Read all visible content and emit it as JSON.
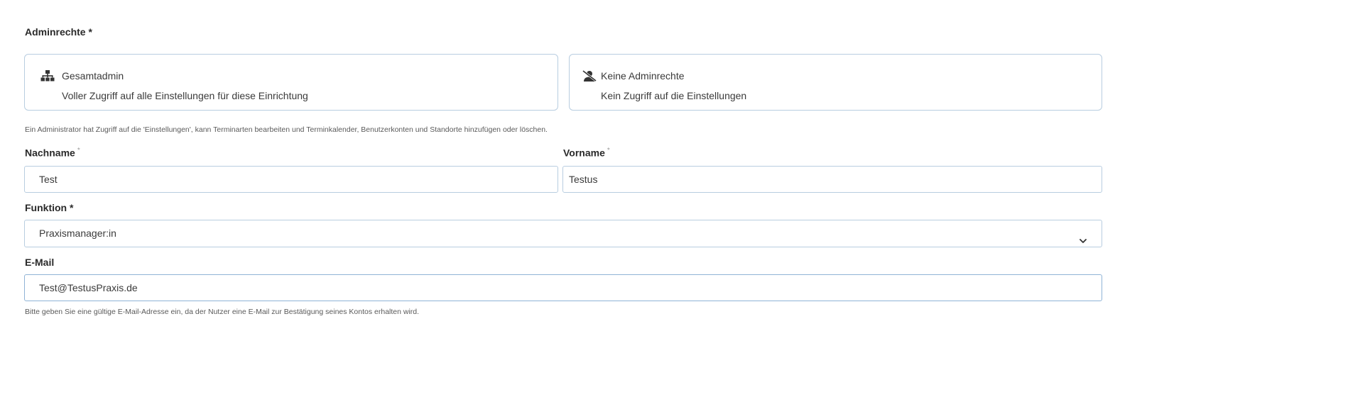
{
  "admin_rights": {
    "label": "Adminrechte *",
    "options": [
      {
        "icon": "sitemap-icon",
        "title": "Gesamtadmin",
        "description": "Voller Zugriff auf alle Einstellungen für diese Einrichtung"
      },
      {
        "icon": "user-slash-icon",
        "title": "Keine Adminrechte",
        "description": "Kein Zugriff auf die Einstellungen"
      }
    ],
    "hint": "Ein Administrator hat Zugriff auf die 'Einstellungen', kann Terminarten bearbeiten und Terminkalender, Benutzerkonten und Standorte hinzufügen oder löschen."
  },
  "last_name": {
    "label": "Nachname",
    "required_mark": "*",
    "value": "Test"
  },
  "first_name": {
    "label": "Vorname",
    "required_mark": "*",
    "value": "Testus"
  },
  "function": {
    "label": "Funktion *",
    "selected": "Praxismanager:in"
  },
  "email": {
    "label": "E-Mail",
    "value": "Test@TestusPraxis.de",
    "hint": "Bitte geben Sie eine gültige E-Mail-Adresse ein, da der Nutzer eine E-Mail zur Bestätigung seines Kontos erhalten wird."
  }
}
